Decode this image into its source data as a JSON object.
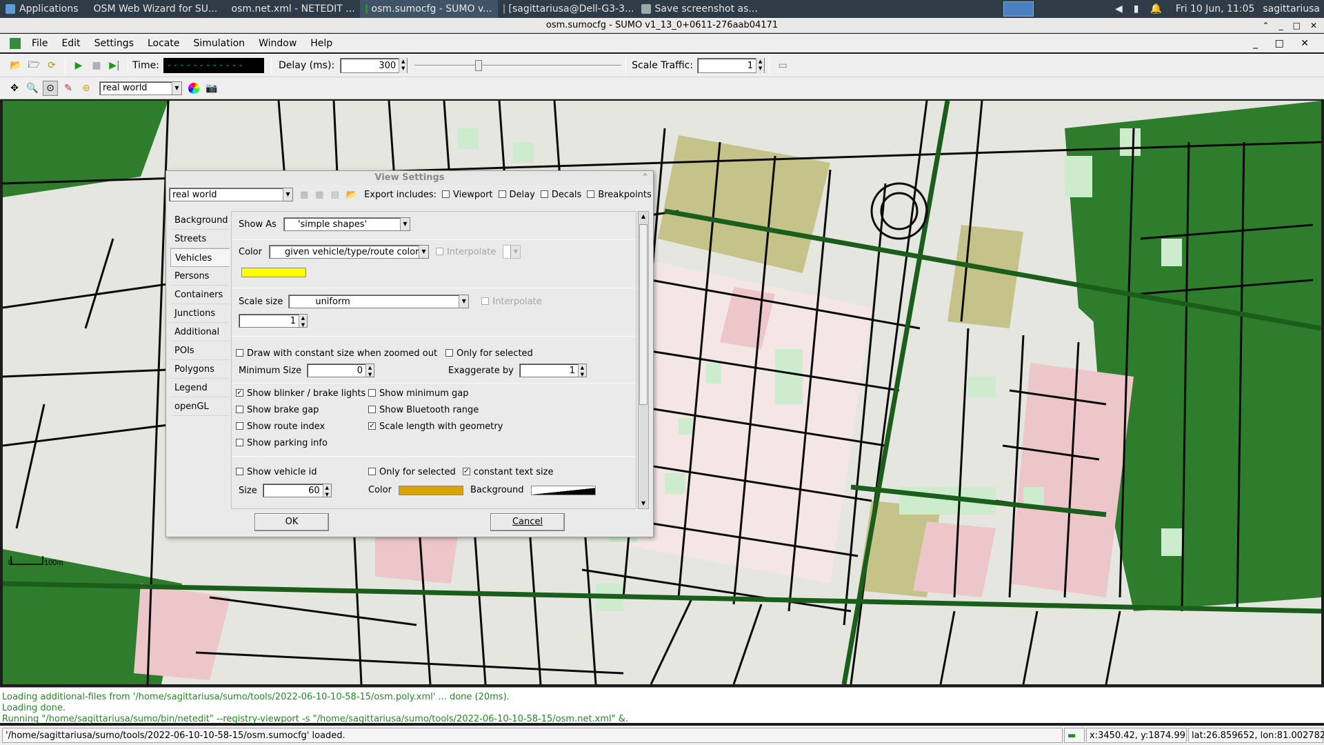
{
  "taskbar": {
    "applications": "Applications",
    "tasks": [
      {
        "label": "OSM Web Wizard for SU...",
        "active": false
      },
      {
        "label": "osm.net.xml - NETEDIT ...",
        "active": false
      },
      {
        "label": "osm.sumocfg - SUMO v...",
        "active": true
      },
      {
        "label": "[sagittariusa@Dell-G3-3...",
        "active": false
      },
      {
        "label": "Save screenshot as...",
        "active": false
      }
    ],
    "clock": "Fri 10 Jun, 11:05",
    "user": "sagittariusa"
  },
  "window": {
    "title": "osm.sumocfg - SUMO v1_13_0+0611-276aab04171"
  },
  "menu": [
    "File",
    "Edit",
    "Settings",
    "Locate",
    "Simulation",
    "Window",
    "Help"
  ],
  "toolbar": {
    "time_label": "Time:",
    "time_value": "------------",
    "delay_label": "Delay (ms):",
    "delay_value": "300",
    "scale_label": "Scale Traffic:",
    "scale_value": "1",
    "scheme": "real world"
  },
  "dialog": {
    "title": "View Settings",
    "scheme": "real world",
    "export_label": "Export includes:",
    "export_options": [
      {
        "label": "Viewport",
        "checked": false
      },
      {
        "label": "Delay",
        "checked": false
      },
      {
        "label": "Decals",
        "checked": false
      },
      {
        "label": "Breakpoints",
        "checked": false
      }
    ],
    "tabs": [
      "Background",
      "Streets",
      "Vehicles",
      "Persons",
      "Containers",
      "Junctions",
      "Additional",
      "POIs",
      "Polygons",
      "Legend",
      "openGL"
    ],
    "selected_tab": "Vehicles",
    "show_as_label": "Show As",
    "show_as_value": "'simple shapes'",
    "color_label": "Color",
    "color_value": "given vehicle/type/route color",
    "interpolate_label": "Interpolate",
    "swatch_color": "#ffff00",
    "scale_size_label": "Scale size",
    "scale_size_value": "uniform",
    "scale_interpolate_label": "Interpolate",
    "scale_value": "1",
    "const_size_label": "Draw with constant size when zoomed out",
    "only_selected_label": "Only for selected",
    "min_size_label": "Minimum Size",
    "min_size_value": "0",
    "exaggerate_label": "Exaggerate by",
    "exaggerate_value": "1",
    "options_left": [
      {
        "label": "Show blinker / brake lights",
        "checked": true
      },
      {
        "label": "Show brake gap",
        "checked": false
      },
      {
        "label": "Show route index",
        "checked": false
      },
      {
        "label": "Show parking info",
        "checked": false
      }
    ],
    "options_right": [
      {
        "label": "Show minimum gap",
        "checked": false
      },
      {
        "label": "Show Bluetooth range",
        "checked": false
      },
      {
        "label": "Scale length with geometry",
        "checked": true
      }
    ],
    "show_id_label": "Show vehicle id",
    "id_only_selected_label": "Only for selected",
    "const_text_label": "constant text size",
    "size_label": "Size",
    "size_value": "60",
    "text_color_label": "Color",
    "text_color": "#d9a400",
    "background_label": "Background",
    "ok_label": "OK",
    "cancel_label": "Cancel"
  },
  "map": {
    "scale_zero": "0",
    "scale_label": "100m"
  },
  "messages": [
    "Loading additional-files from '/home/sagittariusa/sumo/tools/2022-06-10-10-58-15/osm.poly.xml' ... done (20ms).",
    "Loading done.",
    "Running \"/home/sagittariusa/sumo/bin/netedit\" --registry-viewport -s \"/home/sagittariusa/sumo/tools/2022-06-10-10-58-15/osm.net.xml\" &."
  ],
  "status": {
    "text": "'/home/sagittariusa/sumo/tools/2022-06-10-10-58-15/osm.sumocfg' loaded.",
    "xy": "x:3450.42, y:1874.99",
    "latlon": "lat:26.859652, lon:81.002782"
  }
}
